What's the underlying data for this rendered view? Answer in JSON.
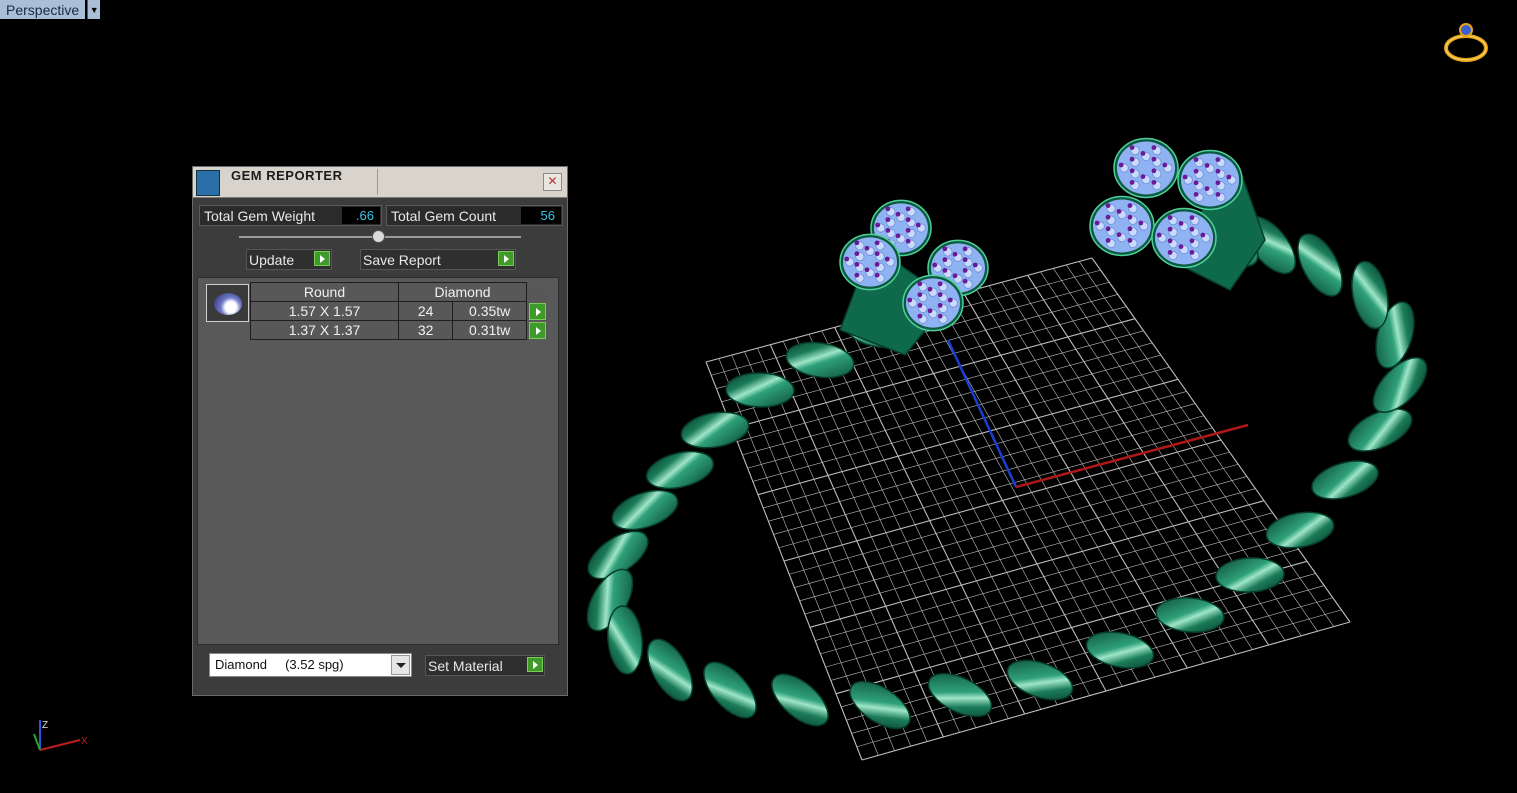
{
  "viewport": {
    "label": "Perspective"
  },
  "gem_reporter": {
    "title": "GEM REPORTER",
    "total_weight_label": "Total Gem Weight",
    "total_weight_value": ".66",
    "total_count_label": "Total Gem Count",
    "total_count_value": "56",
    "update_label": "Update",
    "save_report_label": "Save Report",
    "header": {
      "shape": "Round",
      "material": "Diamond"
    },
    "rows": [
      {
        "size": "1.57 X 1.57",
        "count": "24",
        "weight": "0.35tw"
      },
      {
        "size": "1.37 X 1.37",
        "count": "32",
        "weight": "0.31tw"
      }
    ],
    "material_select": "Diamond     (3.52 spg)",
    "set_material_label": "Set Material"
  },
  "axis": {
    "z_label": "Z",
    "x_label": "X"
  },
  "colors": {
    "metal": "#0f6a4c",
    "gem": "#8fb3f2",
    "prong": "#7a1fa2",
    "grid": "#c8c8c8",
    "x_axis": "#b01818",
    "y_axis": "#1a3fd0"
  }
}
